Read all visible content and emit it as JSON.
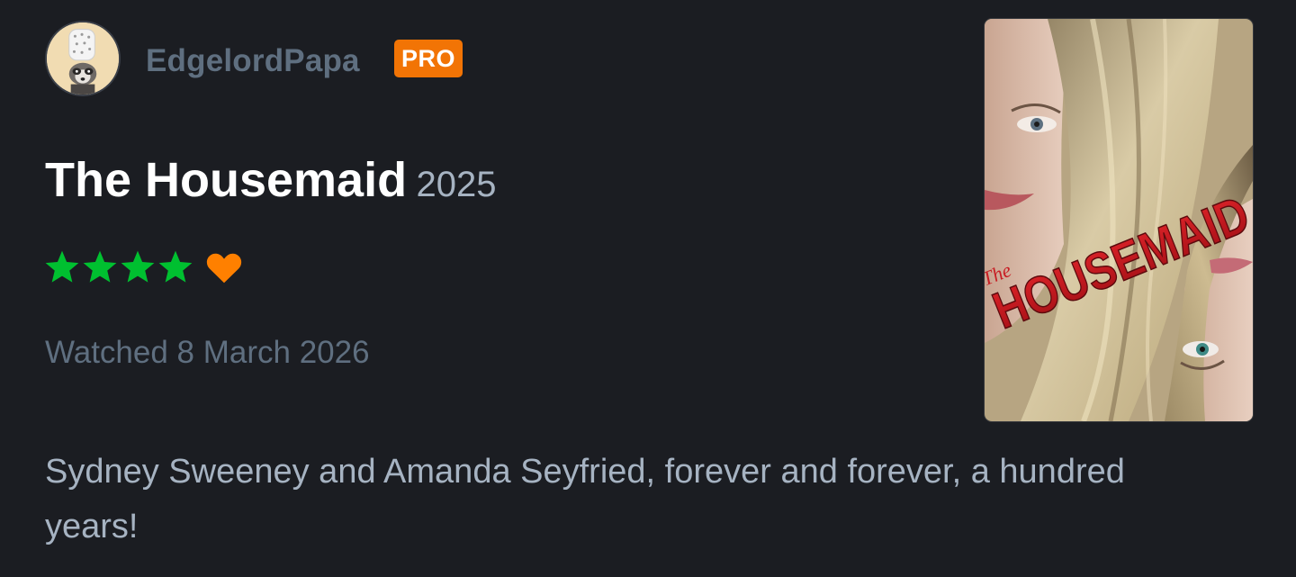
{
  "review": {
    "username": "EdgelordPapa",
    "badge": "PRO",
    "film_title": "The Housemaid",
    "film_year": "2025",
    "rating": {
      "stars": 4,
      "max_stars": 5,
      "liked": true,
      "star_color": "#00c030",
      "like_color": "#ff8000"
    },
    "watched_label": "Watched 8 March 2026",
    "body": "Sydney Sweeney and Amanda Seyfried, forever and forever, a hundred years!"
  },
  "avatar": {
    "icon": "raccoon-chef-avatar"
  },
  "poster": {
    "icon": "film-poster",
    "logo_small": "The",
    "logo_main": "HOUSEMAID"
  },
  "colors": {
    "background": "#1b1d22",
    "badge": "#f27405",
    "muted_text": "#5f6f80",
    "secondary_text": "#a6b3c2"
  }
}
